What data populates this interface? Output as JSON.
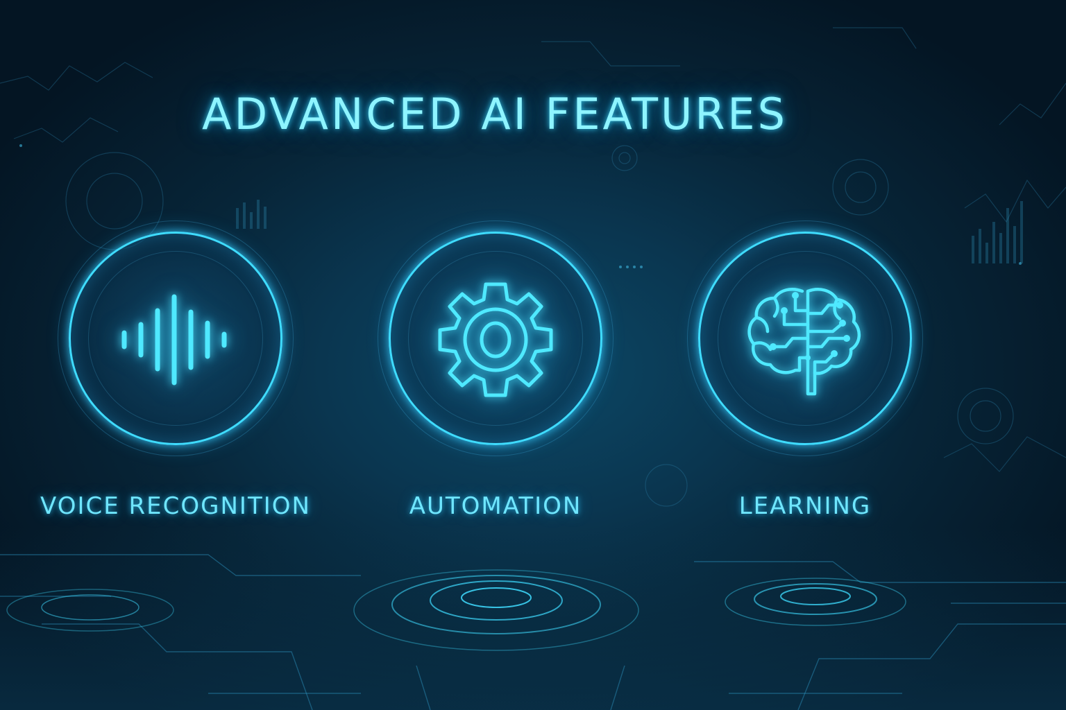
{
  "title": "ADVANCED AI FEATURES",
  "colors": {
    "accent": "#3fdcff",
    "text": "#8ef4ff",
    "background": "#072538"
  },
  "features": [
    {
      "label": "VOICE RECOGNITION",
      "icon": "sound-wave-icon"
    },
    {
      "label": "AUTOMATION",
      "icon": "gear-icon"
    },
    {
      "label": "LEARNING",
      "icon": "brain-circuit-icon"
    }
  ]
}
